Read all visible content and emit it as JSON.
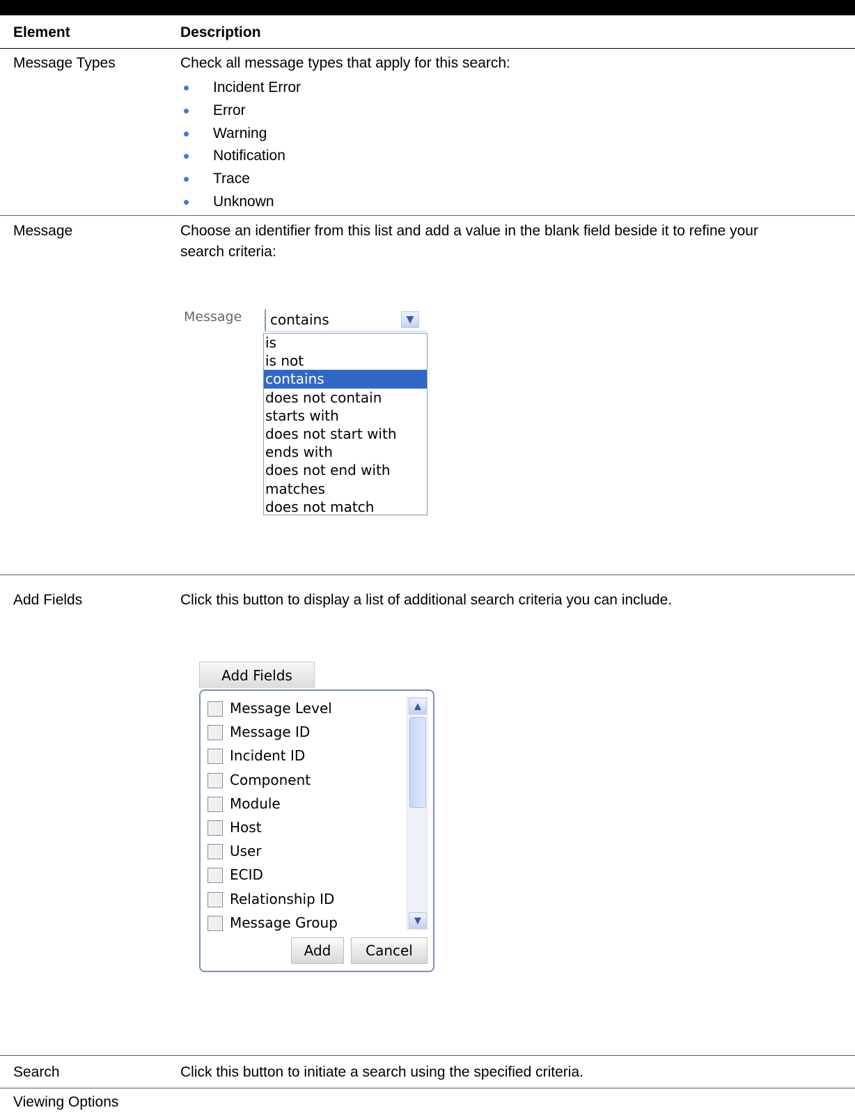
{
  "table": {
    "header": {
      "element": "Element",
      "description": "Description"
    },
    "rows": [
      {
        "element": "Message Types",
        "description": "Check all message types that apply for this search:",
        "bullets": [
          "Incident Error",
          "Error",
          "Warning",
          "Notification",
          "Trace",
          "Unknown"
        ]
      },
      {
        "element": "Message",
        "description_line1": "Choose an identifier from this list and add a value in the blank field beside it to refine your",
        "description_line2": "search criteria:"
      },
      {
        "element": "Add Fields",
        "description": "Click this button to display a list of additional search criteria you can include."
      },
      {
        "element": "Search",
        "description": "Click this button to initiate a search using the specified criteria."
      },
      {
        "element": "Viewing Options",
        "description": ""
      }
    ]
  },
  "message_dropdown": {
    "label": "Message",
    "selected": "contains",
    "options": [
      "is",
      "is not",
      "contains",
      "does not contain",
      "starts with",
      "does not start with",
      "ends with",
      "does not end with",
      "matches",
      "does not match"
    ]
  },
  "add_fields_panel": {
    "button_label": "Add Fields",
    "items": [
      "Message Level",
      "Message ID",
      "Incident ID",
      "Component",
      "Module",
      "Host",
      "User",
      "ECID",
      "Relationship ID",
      "Message Group"
    ],
    "add_label": "Add",
    "cancel_label": "Cancel"
  },
  "colors": {
    "bullet": "#3a7bd5",
    "selection": "#3168c8"
  },
  "icons": {
    "dropdown_arrow": "chevron-down-icon",
    "scroll_up": "chevron-up-icon",
    "scroll_down": "chevron-down-icon"
  }
}
